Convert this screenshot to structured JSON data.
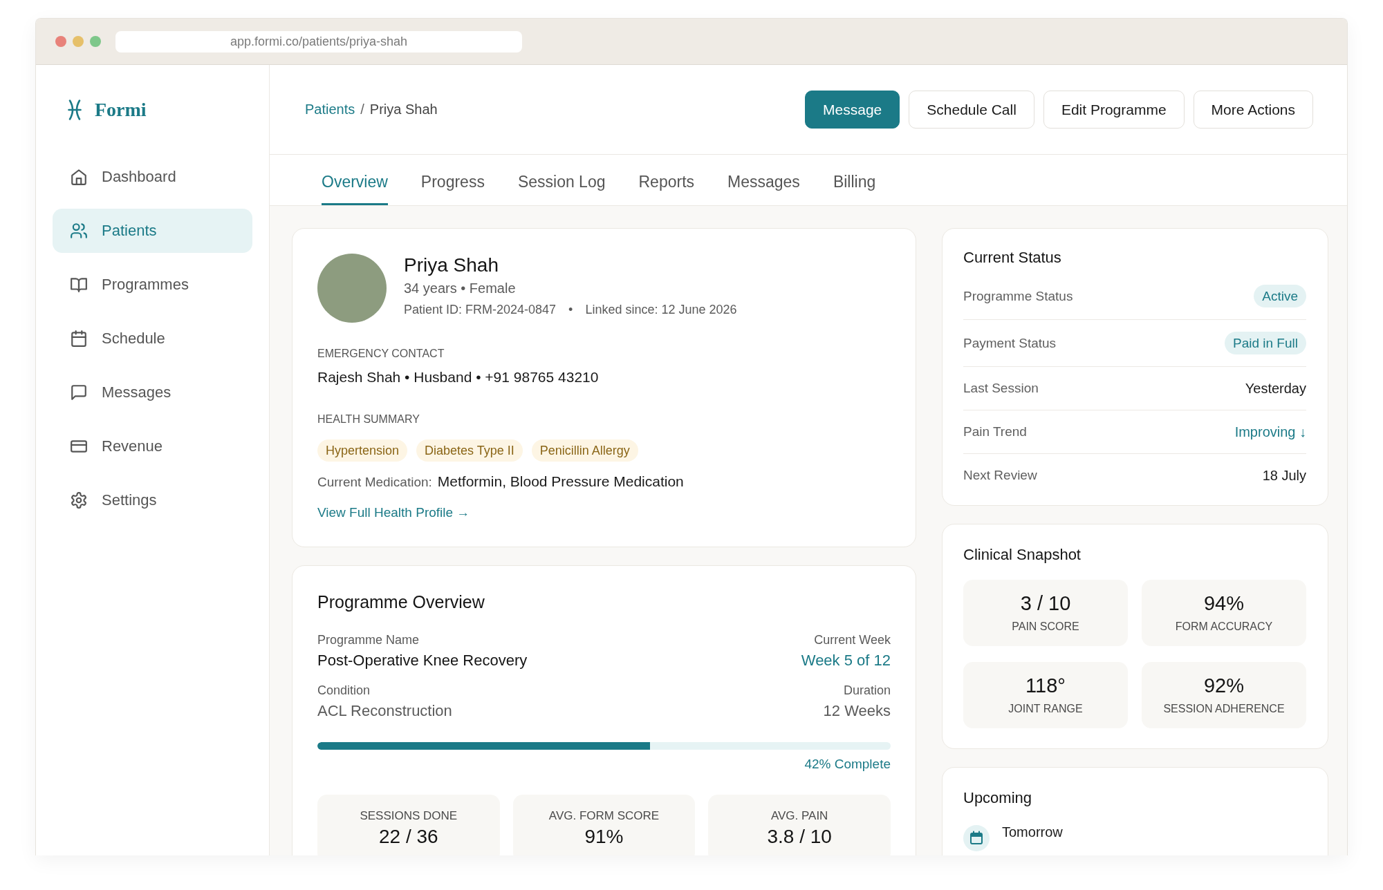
{
  "browser": {
    "url": "app.formi.co/patients/priya-shah"
  },
  "sidebar": {
    "logo": "Formi",
    "items": [
      {
        "label": "Dashboard",
        "selected": false
      },
      {
        "label": "Patients",
        "selected": true
      },
      {
        "label": "Programmes",
        "selected": false
      },
      {
        "label": "Schedule",
        "selected": false
      },
      {
        "label": "Messages",
        "selected": false
      },
      {
        "label": "Revenue",
        "selected": false
      },
      {
        "label": "Settings",
        "selected": false
      }
    ]
  },
  "header": {
    "breadcrumb": {
      "items": [
        {
          "label": "Patients",
          "kind": "link"
        },
        {
          "label": "Priya Shah",
          "kind": "current"
        }
      ],
      "separator": "/"
    },
    "buttons": [
      {
        "label": "Message",
        "kind": "primary"
      },
      {
        "label": "Schedule Call",
        "kind": "secondary"
      },
      {
        "label": "Edit Programme",
        "kind": "secondary"
      },
      {
        "label": "More Actions",
        "kind": "secondary"
      }
    ]
  },
  "tabs": [
    {
      "label": "Overview",
      "selected": true
    },
    {
      "label": "Progress",
      "selected": false
    },
    {
      "label": "Session Log",
      "selected": false
    },
    {
      "label": "Reports",
      "selected": false
    },
    {
      "label": "Messages",
      "selected": false
    },
    {
      "label": "Billing",
      "selected": false
    }
  ],
  "patient": {
    "name": "Priya Shah",
    "details": "34 years • Female",
    "meta": [
      "Patient ID: FRM-2024-0847",
      "Linked since: 12 June 2026"
    ],
    "meta_separator": "•",
    "emergency_contact": {
      "heading": "EMERGENCY CONTACT",
      "value": "Rajesh Shah • Husband • +91 98765 43210"
    },
    "health_summary": {
      "heading": "HEALTH SUMMARY",
      "tags": [
        "Hypertension",
        "Diabetes Type II",
        "Penicillin Allergy"
      ],
      "medication_label": "Current Medication:",
      "medication": "Metformin, Blood Pressure Medication"
    },
    "profile_link": "View Full Health Profile →"
  },
  "programme_overview": {
    "title": "Programme Overview",
    "fields": [
      [
        {
          "label": "Programme Name",
          "value": "Post-Operative Knee Recovery",
          "kind": "strong"
        },
        {
          "label": "Current Week",
          "value": "Week 5 of 12",
          "kind": "accent"
        }
      ],
      [
        {
          "label": "Condition",
          "value": "ACL Reconstruction",
          "kind": "muted"
        },
        {
          "label": "Duration",
          "value": "12 Weeks",
          "kind": "muted"
        }
      ]
    ],
    "progress": {
      "level": 0.58,
      "label": "42% Complete"
    },
    "stats": [
      {
        "label": "SESSIONS DONE",
        "value": "22 / 36"
      },
      {
        "label": "AVG. FORM SCORE",
        "value": "91%"
      },
      {
        "label": "AVG. PAIN",
        "value": "3.8 / 10"
      }
    ]
  },
  "current_status": {
    "title": "Current Status",
    "rows": [
      {
        "label": "Programme Status",
        "value": "Active",
        "kind": "badge"
      },
      {
        "label": "Payment Status",
        "value": "Paid in Full",
        "kind": "badge"
      },
      {
        "label": "Last Session",
        "value": "Yesterday",
        "kind": "text"
      },
      {
        "label": "Pain Trend",
        "value": "Improving ↓",
        "kind": "trend"
      },
      {
        "label": "Next Review",
        "value": "18 July",
        "kind": "text"
      }
    ]
  },
  "clinical_snapshot": {
    "title": "Clinical Snapshot",
    "metrics": [
      {
        "value": "3 / 10",
        "label": "PAIN SCORE"
      },
      {
        "value": "94%",
        "label": "FORM ACCURACY"
      },
      {
        "value": "118°",
        "label": "JOINT RANGE"
      },
      {
        "value": "92%",
        "label": "SESSION ADHERENCE"
      }
    ]
  },
  "upcoming": {
    "title": "Upcoming",
    "items": [
      {
        "when": "Tomorrow"
      }
    ]
  }
}
